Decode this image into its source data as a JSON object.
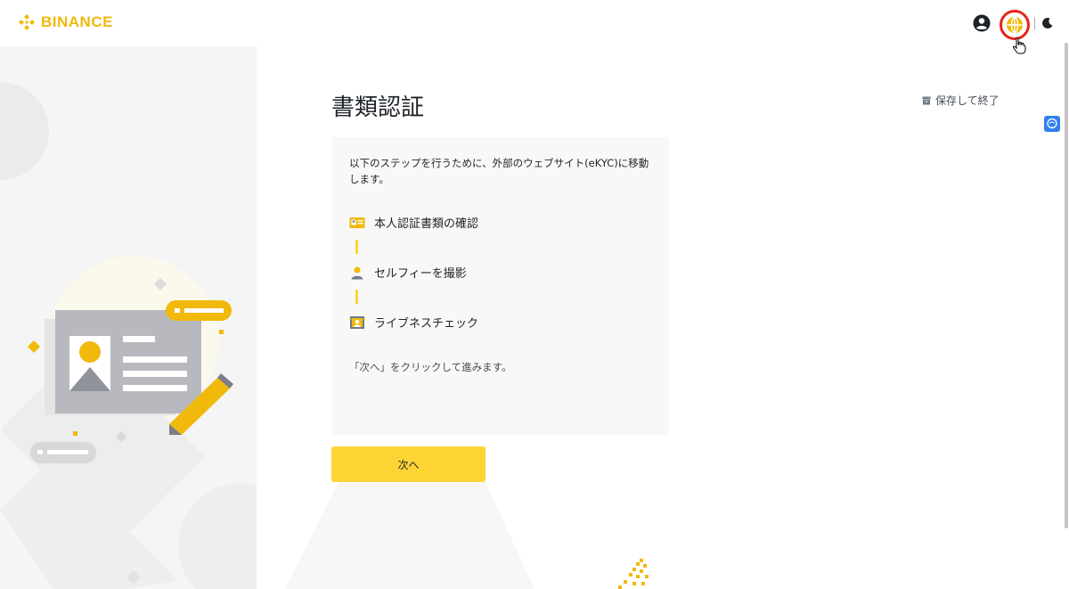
{
  "header": {
    "brand": "BINANCE",
    "icons": {
      "user": "user-circle-icon",
      "language": "globe-icon",
      "theme": "moon-icon"
    }
  },
  "page": {
    "title": "書類認証",
    "save_exit": "保存して終了",
    "intro": "以下のステップを行うために、外部のウェブサイト(eKYC)に移動します。",
    "steps": [
      {
        "label": "本人認証書類の確認",
        "icon": "id-card-icon"
      },
      {
        "label": "セルフィーを撮影",
        "icon": "person-icon"
      },
      {
        "label": "ライブネスチェック",
        "icon": "liveness-icon"
      }
    ],
    "hint": "「次へ」をクリックして進みます。",
    "next_button": "次へ"
  },
  "colors": {
    "brand": "#F0B90B",
    "accent": "#FCD535",
    "highlight_ring": "#e8231a",
    "card_bg": "#f8f8f6"
  }
}
